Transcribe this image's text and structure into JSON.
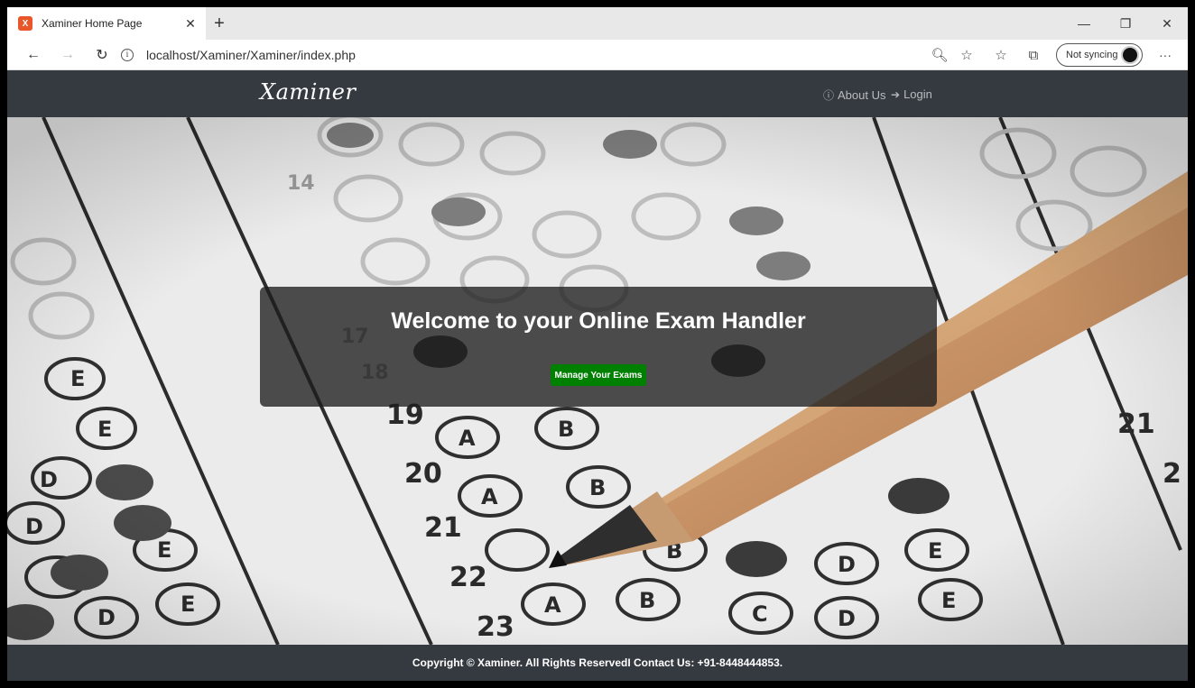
{
  "browser": {
    "tab": {
      "title": "Xaminer Home Page",
      "favicon_icon": "xampp-icon"
    },
    "url": "localhost/Xaminer/Xaminer/index.php",
    "sync_label": "Not syncing",
    "icons": {
      "back": "back-arrow-icon",
      "forward": "forward-arrow-icon",
      "refresh": "refresh-icon",
      "site_info": "info-icon",
      "zoom": "zoom-icon",
      "favorite": "star-icon",
      "favorites_list": "favorites-icon",
      "collections": "collections-icon",
      "more": "more-icon"
    }
  },
  "site": {
    "brand": "Xaminer",
    "nav": {
      "about_label": "About Us",
      "login_label": "Login"
    },
    "hero": {
      "title": "Welcome to your Online Exam Handler",
      "button_label": "Manage Your Exams",
      "button_color": "#008000"
    },
    "footer": {
      "text": "Copyright © Xaminer. All Rights ReservedI Contact Us: +91-8448444853."
    },
    "colors": {
      "navbar": "#343a40",
      "footer": "#343a40"
    }
  }
}
